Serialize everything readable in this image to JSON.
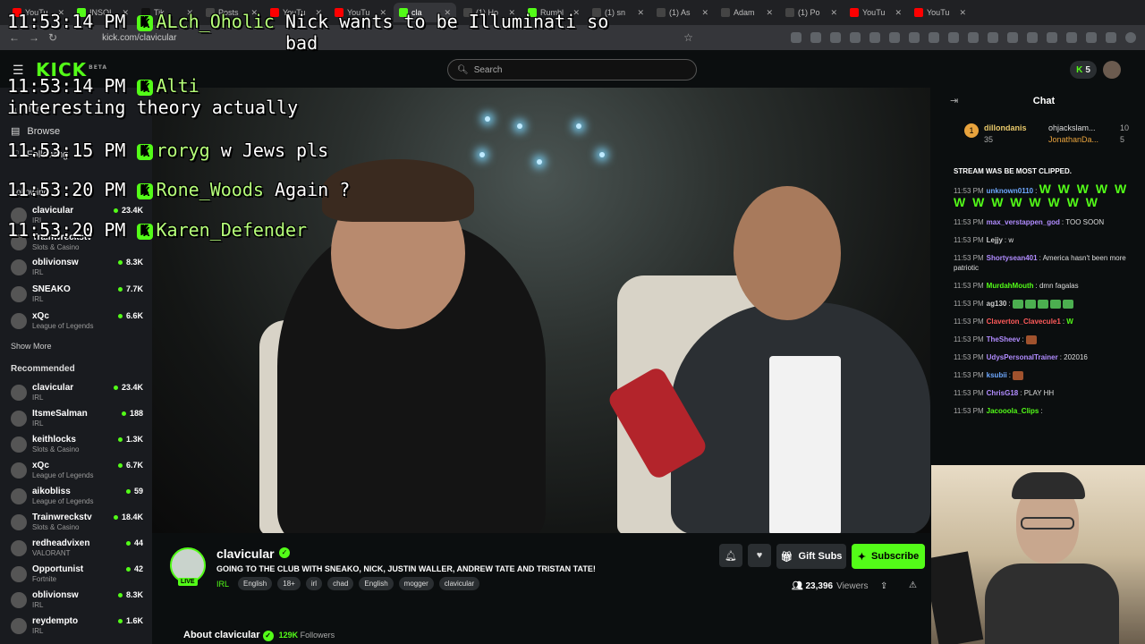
{
  "browser": {
    "tabs": [
      "YouTu",
      "INSOI",
      "Tik",
      "Posts",
      "YouTu",
      "YouTu",
      "cla",
      "(1) Ho",
      "Rumbl",
      "(1) sn",
      "(1) As",
      "Adam",
      "(1) Po",
      "YouTu",
      "YouTu"
    ],
    "active_tab_index": 6,
    "url": "kick.com/clavicular"
  },
  "header": {
    "logo": "KICK",
    "logo_beta": "BETA",
    "search_placeholder": "Search",
    "points": "5"
  },
  "overlay_chat": [
    {
      "time": "11:53:14 PM",
      "user": "ALch_Oholic",
      "text": "Nick wants to be Illuminati so bad"
    },
    {
      "time": "11:53:14 PM",
      "user": "Alti",
      "text": "interesting theory actually"
    },
    {
      "time": "11:53:15 PM",
      "user": "roryg",
      "text": "w Jews pls"
    },
    {
      "time": "11:53:20 PM",
      "user": "Rone_Woods",
      "text": "Again ?"
    },
    {
      "time": "11:53:20 PM",
      "user": "Karen_Defender",
      "text": ""
    }
  ],
  "sidebar": {
    "nav": [
      {
        "label": "Home",
        "icon": "home-icon"
      },
      {
        "label": "Browse",
        "icon": "browse-icon"
      },
      {
        "label": "Following",
        "icon": "heart-icon"
      }
    ],
    "following_title": "Following",
    "following": [
      {
        "name": "clavicular",
        "category": "IRL",
        "viewers": "23.4K"
      },
      {
        "name": "Trainwreckstv",
        "category": "Slots & Casino",
        "viewers": ""
      },
      {
        "name": "oblivionsw",
        "category": "IRL",
        "viewers": "8.3K"
      },
      {
        "name": "SNEAKO",
        "category": "IRL",
        "viewers": "7.7K"
      },
      {
        "name": "xQc",
        "category": "League of Legends",
        "viewers": "6.6K"
      }
    ],
    "show_more": "Show More",
    "recommended_title": "Recommended",
    "recommended": [
      {
        "name": "clavicular",
        "category": "IRL",
        "viewers": "23.4K"
      },
      {
        "name": "ItsmeSalman",
        "category": "IRL",
        "viewers": "188"
      },
      {
        "name": "keithlocks",
        "category": "Slots & Casino",
        "viewers": "1.3K"
      },
      {
        "name": "xQc",
        "category": "League of Legends",
        "viewers": "6.7K"
      },
      {
        "name": "aikobliss",
        "category": "League of Legends",
        "viewers": "59"
      },
      {
        "name": "Trainwreckstv",
        "category": "Slots & Casino",
        "viewers": "18.4K"
      },
      {
        "name": "redheadvixen",
        "category": "VALORANT",
        "viewers": "44"
      },
      {
        "name": "Opportunist",
        "category": "Fortnite",
        "viewers": "42"
      },
      {
        "name": "oblivionsw",
        "category": "IRL",
        "viewers": "8.3K"
      },
      {
        "name": "reydempto",
        "category": "IRL",
        "viewers": "1.6K"
      }
    ]
  },
  "stream": {
    "channel": "clavicular",
    "live_label": "LIVE",
    "title": "GOING TO THE CLUB WITH SNEAKO, NICK, JUSTIN WALLER, ANDREW TATE AND TRISTAN TATE!",
    "category": "IRL",
    "tags": [
      "English",
      "18+",
      "irl",
      "chad",
      "English",
      "mogger",
      "clavicular"
    ],
    "gift_label": "Gift Subs",
    "subscribe_label": "Subscribe",
    "viewers": "23,396",
    "viewers_label": "Viewers",
    "about_label": "About clavicular",
    "followers": "129K",
    "followers_label": "Followers"
  },
  "chat": {
    "title": "Chat",
    "leaderboard": [
      {
        "name": "dillondanis",
        "value": "35"
      },
      {
        "name": "ohjackslam...",
        "value": "10"
      },
      {
        "name": "JonathanDa...",
        "value": "5"
      }
    ],
    "banner": "STREAM WAS BE MOST CLIPPED.",
    "messages": [
      {
        "time": "11:53 PM",
        "user": "unknown0110",
        "color": "#6ea8ff",
        "text": "W W W W W W W W W W W W W"
      },
      {
        "time": "11:53 PM",
        "user": "max_verstappen_god",
        "color": "#b18cff",
        "text": "TOO SOON"
      },
      {
        "time": "11:53 PM",
        "user": "Lejjy",
        "color": "#cfcfcf",
        "text": "w"
      },
      {
        "time": "11:53 PM",
        "user": "Shortysean401",
        "color": "#b18cff",
        "text": "America hasn't been more patriotic"
      },
      {
        "time": "11:53 PM",
        "user": "MurdahMouth",
        "color": "#53fc18",
        "text": "dmn fagalas"
      },
      {
        "time": "11:53 PM",
        "user": "ag130",
        "color": "#cfcfcf",
        "text": ""
      },
      {
        "time": "11:53 PM",
        "user": "Claverton_Clavecule1",
        "color": "#ff5a5a",
        "text": "W"
      },
      {
        "time": "11:53 PM",
        "user": "TheSheev",
        "color": "#b18cff",
        "text": ""
      },
      {
        "time": "11:53 PM",
        "user": "UdysPersonalTrainer",
        "color": "#b18cff",
        "text": "202016"
      },
      {
        "time": "11:53 PM",
        "user": "ksubii",
        "color": "#6ea8ff",
        "text": ""
      },
      {
        "time": "11:53 PM",
        "user": "ChrisG18",
        "color": "#b18cff",
        "text": "PLAY HH"
      },
      {
        "time": "11:53 PM",
        "user": "Jacooola_Clips",
        "color": "#53fc18",
        "text": ""
      }
    ]
  },
  "colors": {
    "accent": "#53fc18"
  }
}
